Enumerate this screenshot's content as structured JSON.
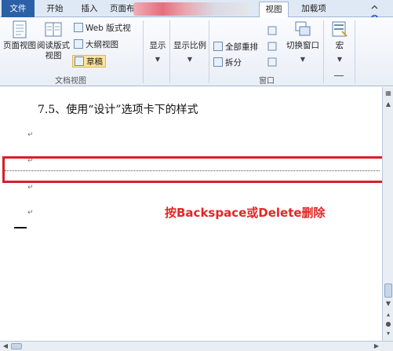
{
  "tabs": {
    "file": "文件",
    "home": "开始",
    "insert": "插入",
    "page_layout": "页面布",
    "view": "视图",
    "addins": "加载项"
  },
  "ribbon": {
    "views_group": {
      "label": "文档视图",
      "print_layout": "页面视图",
      "full_screen_reading_1": "阅读版式",
      "full_screen_reading_2": "视图",
      "web_layout": "Web 版式视",
      "outline": "大纲视图",
      "draft": "草稿"
    },
    "show": {
      "label": "显示"
    },
    "zoom": {
      "label": "显示比例"
    },
    "window_group": {
      "label": "窗口",
      "arrange_all": "全部重排",
      "split": "拆分",
      "switch_windows": "切换窗口"
    },
    "macros": {
      "label": "宏"
    }
  },
  "document": {
    "heading": "7.5、使用“设计”选项卡下的样式",
    "annotation": "按Backspace或Delete删除"
  },
  "colors": {
    "file_tab": "#2b5fa6",
    "highlight_box": "#d5202a",
    "annotation_text": "#e32626",
    "draft_selected": "#fbe39b"
  }
}
